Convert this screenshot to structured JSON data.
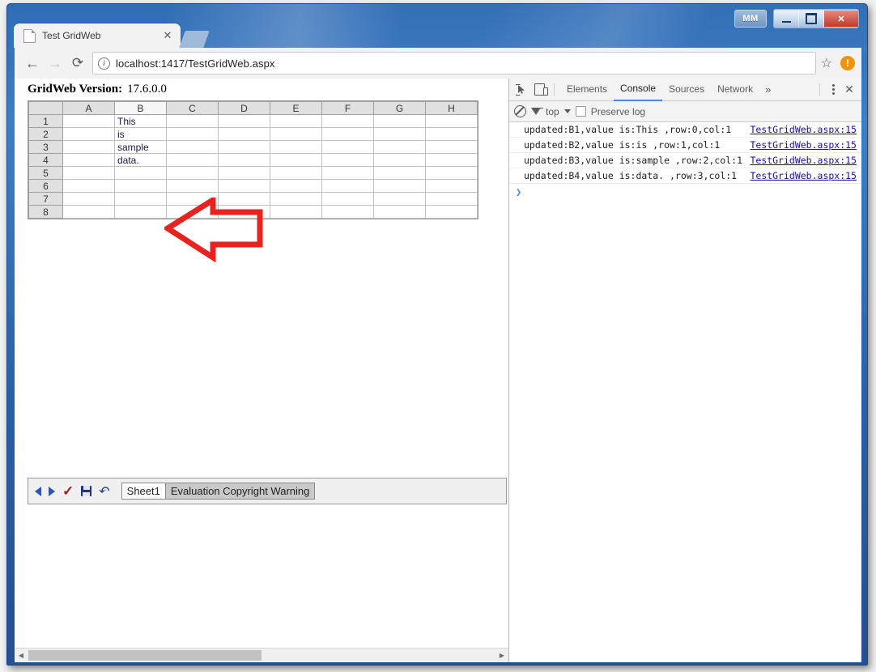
{
  "window": {
    "user_badge": "MM",
    "minimize_label": "minimize",
    "maximize_label": "maximize",
    "close_label": "✕"
  },
  "browser": {
    "tab_title": "Test GridWeb",
    "tab_close": "✕",
    "back_label": "←",
    "forward_label": "→",
    "reload_label": "⟳",
    "site_info": "i",
    "url": "localhost:1417/TestGridWeb.aspx",
    "bookmark_star": "☆",
    "update_badge": "!"
  },
  "page": {
    "version_label": "GridWeb Version:",
    "version_value": "17.6.0.0",
    "grid": {
      "columns": [
        "A",
        "B",
        "C",
        "D",
        "E",
        "F",
        "G",
        "H"
      ],
      "selected_column": "B",
      "rows": [
        {
          "number": "1",
          "cells": [
            "",
            "This",
            "",
            "",
            "",
            "",
            "",
            ""
          ]
        },
        {
          "number": "2",
          "cells": [
            "",
            "is",
            "",
            "",
            "",
            "",
            "",
            ""
          ]
        },
        {
          "number": "3",
          "cells": [
            "",
            "sample",
            "",
            "",
            "",
            "",
            "",
            ""
          ]
        },
        {
          "number": "4",
          "cells": [
            "",
            "data.",
            "",
            "",
            "",
            "",
            "",
            ""
          ]
        },
        {
          "number": "5",
          "cells": [
            "",
            "",
            "",
            "",
            "",
            "",
            "",
            ""
          ]
        },
        {
          "number": "6",
          "cells": [
            "",
            "",
            "",
            "",
            "",
            "",
            "",
            ""
          ]
        },
        {
          "number": "7",
          "cells": [
            "",
            "",
            "",
            "",
            "",
            "",
            "",
            ""
          ]
        },
        {
          "number": "8",
          "cells": [
            "",
            "",
            "",
            "",
            "",
            "",
            "",
            ""
          ]
        }
      ]
    },
    "sheetbar": {
      "prev_label": "previous",
      "next_label": "next",
      "submit_label": "✓",
      "save_label": "save",
      "undo_label": "↶",
      "tabs": [
        {
          "label": "Sheet1",
          "active": true
        },
        {
          "label": "Evaluation Copyright Warning",
          "active": false
        }
      ]
    },
    "hscroll": {
      "left_arrow": "◀",
      "right_arrow": "▶"
    }
  },
  "devtools": {
    "inspect_icon_label": "inspect-element",
    "device_icon_label": "device-toolbar",
    "tabs": [
      {
        "label": "Elements",
        "active": false
      },
      {
        "label": "Console",
        "active": true
      },
      {
        "label": "Sources",
        "active": false
      },
      {
        "label": "Network",
        "active": false
      }
    ],
    "more_tabs": "»",
    "settings_label": "more-options",
    "close_label": "✕",
    "filterbar": {
      "clear_label": "clear-console",
      "filter_label": "filter",
      "context": "top",
      "preserve_log": "Preserve log",
      "preserve_log_checked": false
    },
    "console": {
      "messages": [
        {
          "text": "updated:B1,value is:This ,row:0,col:1",
          "source": "TestGridWeb.aspx:15"
        },
        {
          "text": "updated:B2,value is:is ,row:1,col:1",
          "source": "TestGridWeb.aspx:15"
        },
        {
          "text": "updated:B3,value is:sample ,row:2,col:1",
          "source": "TestGridWeb.aspx:15"
        },
        {
          "text": "updated:B4,value is:data. ,row:3,col:1",
          "source": "TestGridWeb.aspx:15"
        }
      ],
      "prompt": "❯"
    }
  },
  "annotations": {
    "arrow_color": "#e8231f",
    "arrow_left_label": "points-to-column-b-cells",
    "arrow_up_label": "points-to-console-messages"
  }
}
